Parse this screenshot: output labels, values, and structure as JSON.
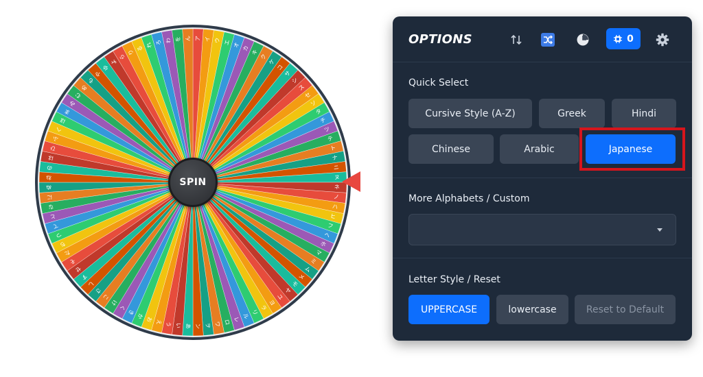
{
  "wheel": {
    "spin_label": "SPIN",
    "colors": [
      "#e74c3c",
      "#f39c12",
      "#f1c40f",
      "#2ecc71",
      "#3498db",
      "#9b59b6",
      "#27ae60",
      "#e67e22",
      "#16a085",
      "#d35400",
      "#1abc9c",
      "#c0392b"
    ],
    "letters": [
      "ア",
      "イ",
      "ウ",
      "エ",
      "オ",
      "カ",
      "キ",
      "ク",
      "ケ",
      "コ",
      "サ",
      "シ",
      "ス",
      "セ",
      "ソ",
      "タ",
      "チ",
      "ツ",
      "テ",
      "ト",
      "ナ",
      "ニ",
      "ヌ",
      "ネ",
      "ノ",
      "ハ",
      "ヒ",
      "フ",
      "ヘ",
      "ホ",
      "マ",
      "ミ",
      "ム",
      "メ",
      "モ",
      "ヤ",
      "ユ",
      "ヨ",
      "ラ",
      "リ",
      "ル",
      "レ",
      "ロ",
      "ワ",
      "ヲ",
      "ン",
      "あ",
      "い",
      "う",
      "え",
      "お",
      "か",
      "き",
      "く",
      "け",
      "こ",
      "さ",
      "し",
      "す",
      "せ",
      "そ",
      "た",
      "ち",
      "つ",
      "て",
      "と",
      "な",
      "に",
      "ぬ",
      "ね",
      "の",
      "は",
      "ひ",
      "ふ",
      "へ",
      "ほ",
      "ま",
      "み",
      "む",
      "め",
      "も",
      "や",
      "ゆ",
      "よ",
      "ら",
      "り",
      "る",
      "れ",
      "ろ",
      "わ",
      "を",
      "ん"
    ]
  },
  "panel": {
    "title": "OPTIONS",
    "counter": "0",
    "quick_select": {
      "label": "Quick Select",
      "buttons": [
        "Cursive Style (A-Z)",
        "Greek",
        "Hindi",
        "Chinese",
        "Arabic",
        "Japanese"
      ]
    },
    "more_alphabets": {
      "label": "More Alphabets / Custom",
      "selected": ""
    },
    "letter_style": {
      "label": "Letter Style / Reset",
      "uppercase": "UPPERCASE",
      "lowercase": "lowercase",
      "reset": "Reset to Default"
    }
  },
  "colors": {
    "panel_bg": "#1e2a3a",
    "accent": "#0d6efd",
    "button_bg": "#3a4555",
    "highlight": "#d6151c",
    "pointer": "#e8473f"
  }
}
